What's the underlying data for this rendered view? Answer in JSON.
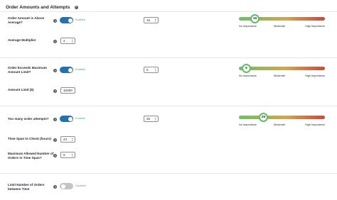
{
  "section": {
    "title": "Order Amounts and Attempts",
    "help": "?"
  },
  "states": {
    "enabled": "Enabled",
    "disabled": "Disabled"
  },
  "importance": {
    "no": "No Importance",
    "moderate": "Moderate",
    "high": "High Importance"
  },
  "groups": [
    {
      "label_line1": "Order Amount is Above",
      "label_line2": "Average?",
      "toggle_on": true,
      "score": "15",
      "slider_value": 15,
      "sub_label": "Average Multiplier",
      "sub_value": "2"
    },
    {
      "label_line1": "Order Exceeds Maximum",
      "label_line2": "Amount Limit?",
      "toggle_on": true,
      "score": "5",
      "slider_value": 5,
      "sub_label": "Amount Limit ($)",
      "sub_value": "10000"
    },
    {
      "label_line1": "Too many order attempts?",
      "toggle_on": true,
      "score": "25",
      "slider_value": 25,
      "sub_label": "Time Span to Check (hours)",
      "sub_value": "24",
      "sub2_label_line1": "Maximum Allowed Number of",
      "sub2_label_line2": "Orders in Time Span?",
      "sub2_value": "5"
    },
    {
      "label_line1": "Limit Number of Orders",
      "label_line2": "between Time",
      "toggle_on": false
    }
  ]
}
